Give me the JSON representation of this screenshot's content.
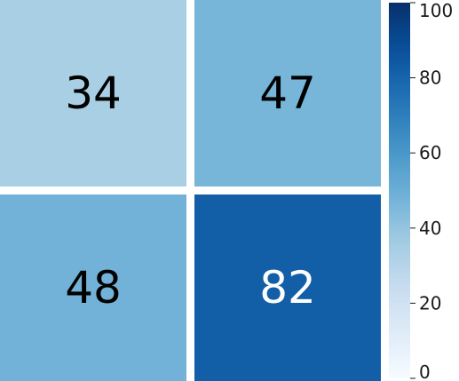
{
  "chart_data": {
    "type": "heatmap",
    "rows": 2,
    "cols": 2,
    "values": [
      [
        34,
        47
      ],
      [
        48,
        82
      ]
    ],
    "annotations": [
      [
        "34",
        "47"
      ],
      [
        "48",
        "82"
      ]
    ],
    "colormap": "Blues",
    "colorbar": {
      "range": [
        0,
        100
      ],
      "ticks": [
        0,
        20,
        40,
        60,
        80,
        100
      ],
      "tick_labels": [
        "0",
        "20",
        "40",
        "60",
        "80",
        "100"
      ],
      "position": "right"
    },
    "cell_separator_color": "#ffffff",
    "annotation_colors": {
      "dark": "#000000",
      "light": "#ffffff"
    }
  }
}
